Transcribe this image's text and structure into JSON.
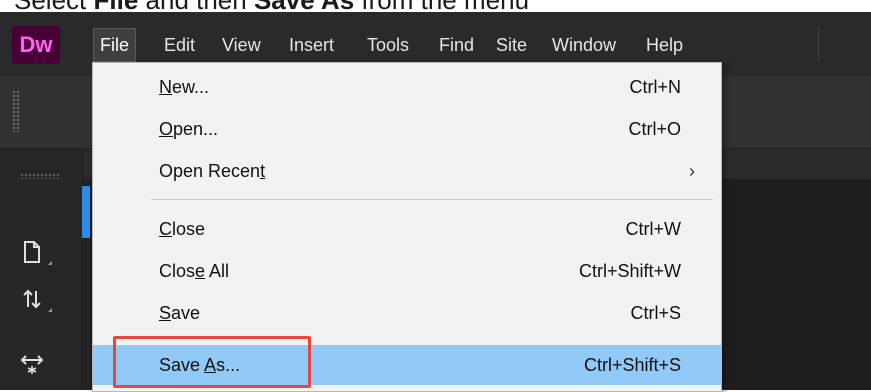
{
  "instruction": {
    "prefix": "Select ",
    "file": "File",
    "middle": " and then ",
    "save_as": "Save As",
    "suffix": " from the menu"
  },
  "app": {
    "logo": "Dw"
  },
  "menubar": {
    "items": [
      "File",
      "Edit",
      "View",
      "Insert",
      "Tools",
      "Find",
      "Site",
      "Window",
      "Help"
    ],
    "active": "File"
  },
  "file_menu": {
    "items": [
      {
        "pre": "",
        "u": "N",
        "post": "ew...",
        "shortcut": "Ctrl+N"
      },
      {
        "pre": "",
        "u": "O",
        "post": "pen...",
        "shortcut": "Ctrl+O"
      },
      {
        "pre": "Open Recen",
        "u": "t",
        "post": "",
        "shortcut": "",
        "submenu_arrow": "›"
      },
      {
        "pre": "",
        "u": "C",
        "post": "lose",
        "shortcut": "Ctrl+W"
      },
      {
        "pre": "Clos",
        "u": "e",
        "post": " All",
        "shortcut": "Ctrl+Shift+W"
      },
      {
        "pre": "",
        "u": "S",
        "post": "ave",
        "shortcut": "Ctrl+S"
      },
      {
        "pre": "Save ",
        "u": "A",
        "post": "s...",
        "shortcut": "Ctrl+Shift+S",
        "highlighted": true
      }
    ]
  },
  "colors": {
    "highlight": "#91c9f7",
    "callout_border": "#e8453c",
    "logo_bg": "#470137",
    "logo_text": "#ff61f6"
  },
  "icons": {
    "side": [
      "new-file-icon",
      "transfer-icon",
      "expand-icon"
    ]
  }
}
